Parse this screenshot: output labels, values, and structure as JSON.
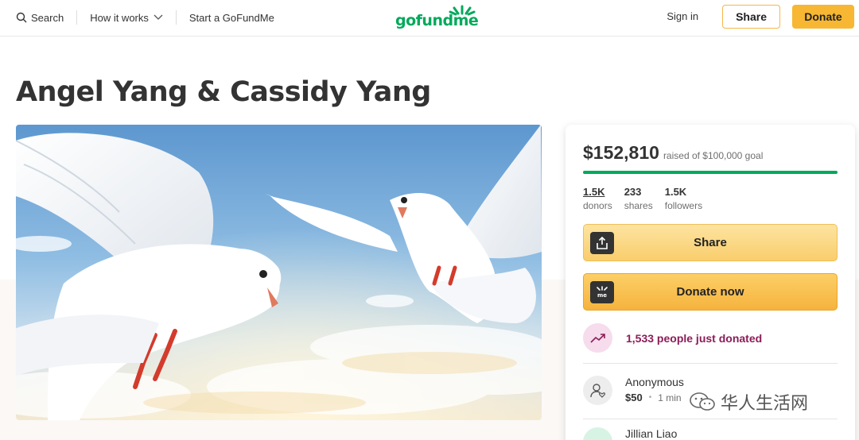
{
  "header": {
    "search_label": "Search",
    "how_it_works_label": "How it works",
    "start_label": "Start a GoFundMe",
    "logo_text": "gofundme",
    "signin_label": "Sign in",
    "share_label": "Share",
    "donate_label": "Donate"
  },
  "campaign": {
    "title": "Angel Yang & Cassidy Yang",
    "image_alt": "Two white doves flying in a blue sky"
  },
  "fundraising": {
    "amount_raised": "$152,810",
    "goal_text": "raised of $100,000 goal",
    "progress_fraction": 1.0,
    "stats": [
      {
        "value": "1.5K",
        "label": "donors"
      },
      {
        "value": "233",
        "label": "shares"
      },
      {
        "value": "1.5K",
        "label": "followers"
      }
    ],
    "share_button_label": "Share",
    "donate_button_label": "Donate now",
    "recent_activity": "1,533 people just donated",
    "donations": [
      {
        "name": "Anonymous",
        "amount": "$50",
        "time": "1 min"
      },
      {
        "name": "Jillian Liao"
      }
    ]
  },
  "watermark": {
    "text": "华人生活网"
  },
  "colors": {
    "brand_green": "#02a95c",
    "donate_yellow": "#f7b733",
    "activity_purple": "#8c1c58"
  }
}
